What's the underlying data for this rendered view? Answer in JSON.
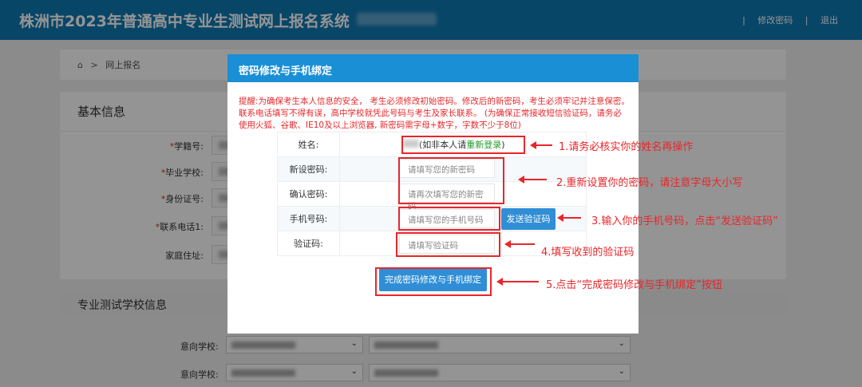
{
  "header": {
    "title": "株洲市2023年普通高中专业生测试网上报名系统",
    "change_password": "修改密码",
    "logout": "退出",
    "separator": "|"
  },
  "breadcrumb": {
    "home_icon": "home-icon",
    "sep": ">",
    "current": "网上报名"
  },
  "basic": {
    "title": "基本信息",
    "fields": [
      {
        "label": "学籍号:",
        "required": true
      },
      {
        "label": "毕业学校:",
        "required": true
      },
      {
        "label": "身份证号:",
        "required": true
      },
      {
        "label": "联系电话1:",
        "required": true
      },
      {
        "label": "家庭住址:",
        "required": false
      }
    ]
  },
  "school": {
    "title": "专业测试学校信息",
    "rows": [
      {
        "label": "意向学校:"
      },
      {
        "label": "意向学校:"
      }
    ]
  },
  "modal": {
    "title": "密码修改与手机绑定",
    "tip": "提醒:为确保考生本人信息的安全， 考生必须修改初始密码。修改后的新密码，考生必须牢记并注意保密。 联系电话填写不得有误，高中学校就凭此号码与考生及家长联系。 (为确保正常接收短信验证码，请务必使用火狐、谷歌、IE10及以上浏览器, 新密码需字母+数字，字数不少于8位)",
    "name_label": "姓名:",
    "name_suffix": "(如非本人请",
    "relogin": "重新登录",
    "name_close": ")",
    "new_pw_label": "新设密码:",
    "new_pw_placeholder": "请填写您的新密码",
    "confirm_pw_label": "确认密码:",
    "confirm_pw_placeholder": "请再次填写您的新密码",
    "phone_label": "手机号码:",
    "phone_placeholder": "请填写您的手机号码",
    "send_code": "发送验证码",
    "code_label": "验证码:",
    "code_placeholder": "请填写验证码",
    "submit": "完成密码修改与手机绑定"
  },
  "annotations": [
    "1.请务必核实你的姓名再操作",
    "2.重新设置你的密码，请注意字母大小写",
    "3.输入你的手机号码，点击“发送验证码”",
    "4.填写收到的验证码",
    "5.点击“完成密码修改与手机绑定”按钮"
  ]
}
